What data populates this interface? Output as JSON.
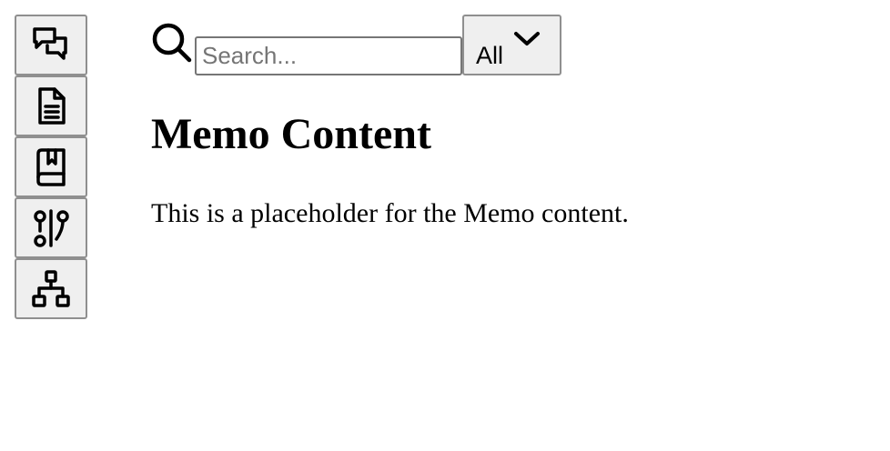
{
  "sidebar": {
    "items": [
      {
        "icon": "chat-bubbles-icon"
      },
      {
        "icon": "document-icon"
      },
      {
        "icon": "bookmark-book-icon"
      },
      {
        "icon": "git-compare-icon"
      },
      {
        "icon": "hierarchy-icon"
      }
    ]
  },
  "search": {
    "placeholder": "Search...",
    "value": ""
  },
  "filter": {
    "selected": "All"
  },
  "main": {
    "title": "Memo Content",
    "body": "This is a placeholder for the Memo content."
  }
}
